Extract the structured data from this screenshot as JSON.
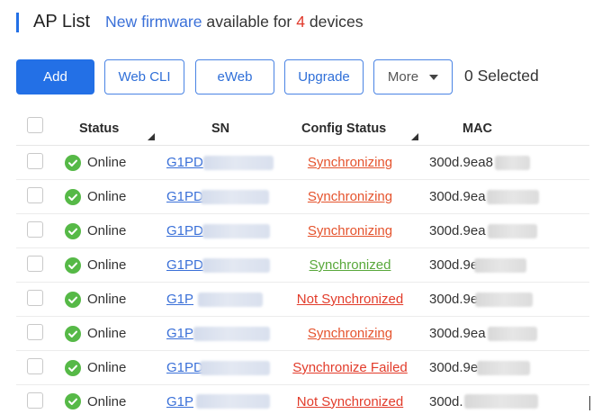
{
  "header": {
    "title": "AP List",
    "notice": {
      "link_text": "New firmware",
      "text_before_count": "available for",
      "count": "4",
      "text_after_count": "devices"
    }
  },
  "toolbar": {
    "add_label": "Add",
    "web_cli_label": "Web CLI",
    "eweb_label": "eWeb",
    "upgrade_label": "Upgrade",
    "more_label": "More",
    "selected_text": "0 Selected"
  },
  "table": {
    "columns": [
      "Status",
      "SN",
      "Config Status",
      "MAC"
    ],
    "rows": [
      {
        "status": "Online",
        "sn": "G1PD",
        "config_status": "Synchronizing",
        "mac": "300d.9ea8"
      },
      {
        "status": "Online",
        "sn": "G1PD",
        "config_status": "Synchronizing",
        "mac": "300d.9ea"
      },
      {
        "status": "Online",
        "sn": "G1PD",
        "config_status": "Synchronizing",
        "mac": "300d.9ea"
      },
      {
        "status": "Online",
        "sn": "G1PD",
        "config_status": "Synchronized",
        "mac": "300d.9e"
      },
      {
        "status": "Online",
        "sn": "G1P",
        "config_status": "Not Synchronized",
        "mac": "300d.9e"
      },
      {
        "status": "Online",
        "sn": "G1P",
        "config_status": "Synchronizing",
        "mac": "300d.9ea"
      },
      {
        "status": "Online",
        "sn": "G1PD",
        "config_status": "Synchronize Failed",
        "mac": "300d.9e"
      },
      {
        "status": "Online",
        "sn": "G1P",
        "config_status": "Not Synchronized",
        "mac": "300d."
      }
    ]
  },
  "colors": {
    "accent": "#2370e6",
    "link": "#3a70d8",
    "count": "#e0392b",
    "online": "#56b947",
    "synchronizing": "#e5532d",
    "synchronized": "#59a83b",
    "not_synchronized": "#e23b2a",
    "synchronize_failed": "#e23b2a"
  },
  "icons": {
    "online_status": "check-circle-icon",
    "column_filter": "filter-triangle-icon",
    "more_dropdown": "chevron-down-icon"
  }
}
